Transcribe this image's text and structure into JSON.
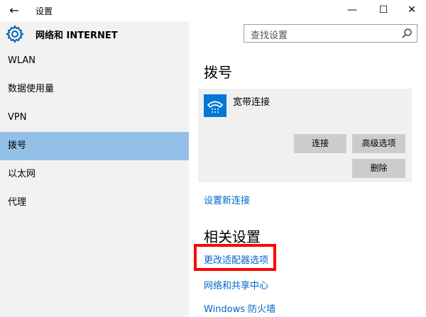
{
  "window": {
    "title": "设置",
    "back_glyph": "←",
    "minimize_glyph": "—",
    "maximize_glyph": "☐",
    "close_glyph": "✕"
  },
  "header": {
    "title": "网络和 INTERNET",
    "search_placeholder": "查找设置"
  },
  "sidebar": {
    "items": [
      {
        "label": "WLAN"
      },
      {
        "label": "数据使用量"
      },
      {
        "label": "VPN"
      },
      {
        "label": "拨号"
      },
      {
        "label": "以太网"
      },
      {
        "label": "代理"
      }
    ],
    "active_index": 3
  },
  "main": {
    "section_dialup": "拨号",
    "connection": {
      "name": "宽带连接",
      "connect_label": "连接",
      "advanced_label": "高级选项",
      "delete_label": "删除"
    },
    "setup_new_link": "设置新连接",
    "section_related": "相关设置",
    "related_links": [
      {
        "label": "更改适配器选项"
      },
      {
        "label": "网络和共享中心"
      },
      {
        "label": "Windows 防火墙"
      }
    ]
  },
  "colors": {
    "accent": "#0078d7",
    "active_nav": "#93c0e6",
    "link": "#0066cc",
    "highlight": "#ff0000"
  }
}
